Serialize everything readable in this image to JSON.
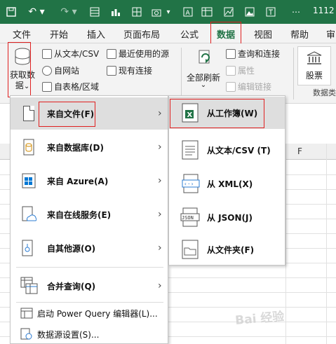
{
  "window": {
    "title": "1112"
  },
  "quick_access": {
    "icons": [
      "save-icon",
      "undo-icon",
      "redo-icon",
      "form-icon",
      "chart-icon",
      "table-icon",
      "camera-icon",
      "dropdown-icon",
      "font-a-icon",
      "table-grid-icon",
      "text-icon"
    ]
  },
  "tabs": [
    "文件",
    "开始",
    "插入",
    "页面布局",
    "公式",
    "数据",
    "视图",
    "帮助",
    "审"
  ],
  "active_tab": "数据",
  "ribbon": {
    "get_data": {
      "line1": "获取数",
      "line2": "据",
      "arrow": "⌄"
    },
    "from_text": "从文本/CSV",
    "from_web": "自网站",
    "from_table": "自表格/区域",
    "recent_sources": "最近使用的源",
    "existing_conn": "现有连接",
    "refresh_all": "全部刷新",
    "refresh_arrow": "⌄",
    "queries_conn": "查询和连接",
    "properties": "属性",
    "edit_links": "编辑链接",
    "stocks": "股票",
    "group_label": "数据类"
  },
  "sheet": {
    "col_f": "F"
  },
  "menu": {
    "items": [
      {
        "label": "来自文件(F)",
        "has_sub": true
      },
      {
        "label": "来自数据库(D)",
        "has_sub": true
      },
      {
        "label": "来自 Azure(A)",
        "has_sub": true
      },
      {
        "label": "来自在线服务(E)",
        "has_sub": true
      },
      {
        "label": "自其他源(O)",
        "has_sub": true
      },
      {
        "label": "合并查询(Q)",
        "has_sub": true
      },
      {
        "label": "启动 Power Query 编辑器(L)...",
        "has_sub": false
      },
      {
        "label": "数据源设置(S)...",
        "has_sub": false
      }
    ],
    "arrow": "›"
  },
  "submenu": {
    "items": [
      {
        "label": "从工作簿(W)",
        "icon": "excel-workbook-icon"
      },
      {
        "label": "从文本/CSV (T)",
        "icon": "text-file-icon"
      },
      {
        "label": "从 XML(X)",
        "icon": "xml-file-icon"
      },
      {
        "label": "从 JSON(J)",
        "icon": "json-file-icon"
      },
      {
        "label": "从文件夹(F)",
        "icon": "folder-file-icon"
      }
    ]
  },
  "watermark": "Bai 经验",
  "colors": {
    "brand": "#217346",
    "highlight": "#dedede",
    "annotation": "#e02020"
  }
}
